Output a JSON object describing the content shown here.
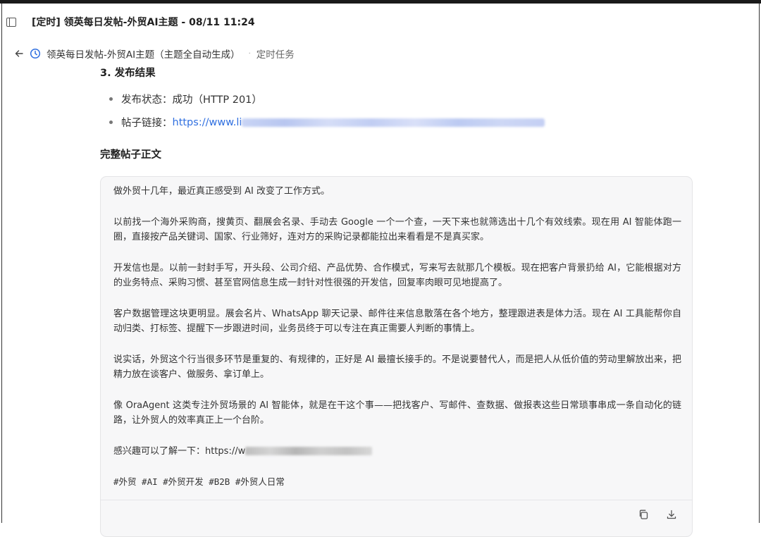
{
  "window": {
    "title": "[定时] 领英每日发帖-外贸AI主题 - 08/11 11:24"
  },
  "breadcrumb": {
    "main": "领英每日发帖-外贸AI主题（主题全自动生成）",
    "separator": "·",
    "sub": "定时任务"
  },
  "section": {
    "heading": "3. 发布结果",
    "status_label": "发布状态：",
    "status_value": "成功（HTTP 201）",
    "link_label": "帖子链接：",
    "link_visible": "https://www.li"
  },
  "full_post": {
    "heading": "完整帖子正文",
    "paragraphs": [
      "做外贸十几年，最近真正感受到 AI 改变了工作方式。",
      "以前找一个海外采购商，搜黄页、翻展会名录、手动去 Google 一个一个查，一天下来也就筛选出十几个有效线索。现在用 AI 智能体跑一圈，直接按产品关键词、国家、行业筛好，连对方的采购记录都能拉出来看看是不是真买家。",
      "开发信也是。以前一封封手写，开头段、公司介绍、产品优势、合作模式，写来写去就那几个模板。现在把客户背景扔给 AI，它能根据对方的业务特点、采购习惯、甚至官网信息生成一封针对性很强的开发信，回复率肉眼可见地提高了。",
      "客户数据管理这块更明显。展会名片、WhatsApp 聊天记录、邮件往来信息散落在各个地方，整理跟进表是体力活。现在 AI 工具能帮你自动归类、打标签、提醒下一步跟进时间，业务员终于可以专注在真正需要人判断的事情上。",
      "说实话，外贸这个行当很多环节是重复的、有规律的，正好是 AI 最擅长接手的。不是说要替代人，而是把人从低价值的劳动里解放出来，把精力放在谈客户、做服务、拿订单上。",
      "像 OraAgent 这类专注外贸场景的 AI 智能体，就是在干这个事——把找客户、写邮件、查数据、做报表这些日常琐事串成一条自动化的链路，让外贸人的效率真正上一个台阶。"
    ],
    "interest_text": "感兴趣可以了解一下：https://w",
    "hashtags": "#外贸 #AI #外贸开发 #B2B #外贸人日常"
  },
  "icons": {
    "sidebar": "sidebar-toggle-icon",
    "back": "back-arrow-icon",
    "clock": "clock-icon",
    "copy": "copy-icon",
    "download": "download-icon"
  }
}
